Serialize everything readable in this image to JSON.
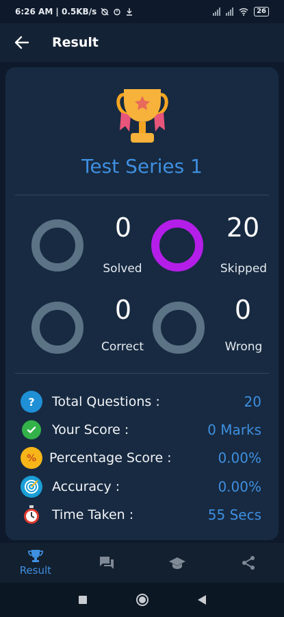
{
  "statusbar": {
    "time_info": "6:26 AM | 0.5KB/s",
    "battery": "26"
  },
  "appbar": {
    "title": "Result"
  },
  "result": {
    "test_name": "Test Series 1",
    "stats": [
      {
        "value": "0",
        "label": "Solved",
        "ring_color": "#5b7385",
        "progress": 0
      },
      {
        "value": "20",
        "label": "Skipped",
        "ring_color": "#b41ee8",
        "progress": 1
      },
      {
        "value": "0",
        "label": "Correct",
        "ring_color": "#5b7385",
        "progress": 0
      },
      {
        "value": "0",
        "label": "Wrong",
        "ring_color": "#5b7385",
        "progress": 0
      }
    ],
    "details": [
      {
        "icon": "question-icon",
        "label": "Total Questions :",
        "value": "20"
      },
      {
        "icon": "check-icon",
        "label": "Your Score :",
        "value": "0 Marks"
      },
      {
        "icon": "percent-icon",
        "label": "Percentage Score :",
        "value": "0.00%"
      },
      {
        "icon": "target-icon",
        "label": "Accuracy :",
        "value": "0.00%"
      },
      {
        "icon": "stopwatch-icon",
        "label": "Time Taken :",
        "value": "55 Secs"
      }
    ]
  },
  "bottomnav": {
    "items": [
      {
        "icon": "trophy-icon",
        "label": "Result",
        "active": true
      },
      {
        "icon": "chat-icon",
        "label": "",
        "active": false
      },
      {
        "icon": "graduation-cap-icon",
        "label": "",
        "active": false
      },
      {
        "icon": "share-icon",
        "label": "",
        "active": false
      }
    ]
  },
  "colors": {
    "accent": "#3f8fe0",
    "background": "#0e1a2b",
    "card": "#172a41",
    "ring_inactive": "#5b7385",
    "ring_active": "#b41ee8"
  }
}
